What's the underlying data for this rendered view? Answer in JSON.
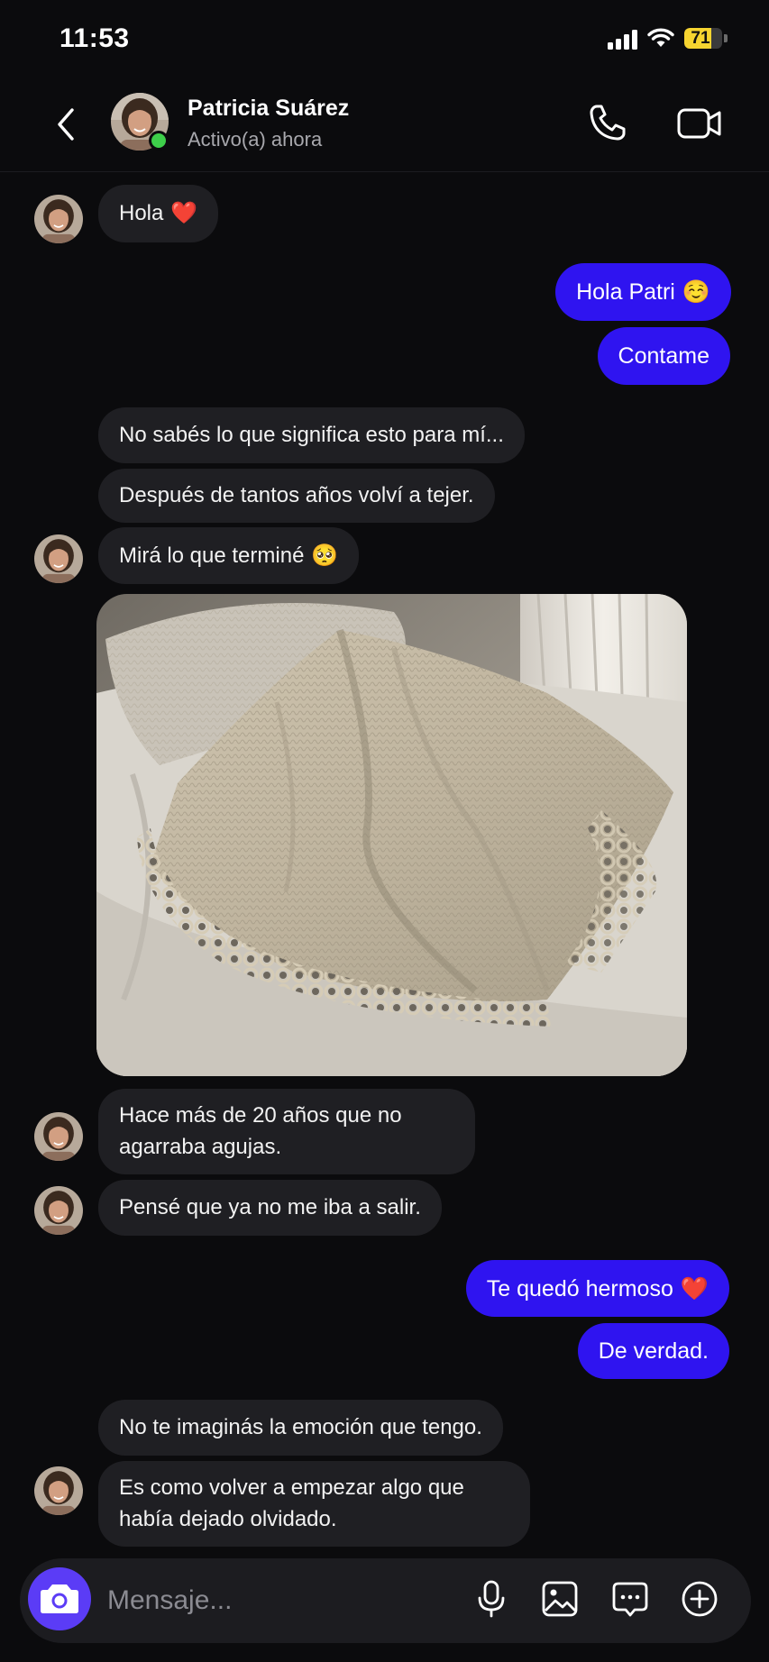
{
  "status_bar": {
    "time": "11:53",
    "battery_level": "71",
    "battery_fraction": 0.71,
    "signal_icon": "cellular-signal-icon",
    "wifi_icon": "wifi-icon"
  },
  "header": {
    "contact_name": "Patricia Suárez",
    "contact_status": "Activo(a) ahora",
    "back_icon": "chevron-left-icon",
    "call_icon": "phone-icon",
    "video_icon": "video-camera-icon"
  },
  "messages": {
    "m1": {
      "text": "Hola",
      "emoji": "❤️"
    },
    "m2": {
      "text": "Hola Patri",
      "emoji": "☺️"
    },
    "m3": {
      "text": "Contame"
    },
    "m4": {
      "text": "No sabés lo que significa esto para mí..."
    },
    "m5": {
      "text": "Después de tantos años volví a tejer."
    },
    "m6": {
      "text": "Mirá lo que terminé",
      "emoji": "🥺"
    },
    "m7": {
      "text": "Hace más de 20 años que no agarraba agujas."
    },
    "m8": {
      "text": "Pensé que ya no me iba a salir."
    },
    "m9": {
      "text": "Te quedó hermoso",
      "emoji": "❤️"
    },
    "m10": {
      "text": "De verdad."
    },
    "m11": {
      "text": "No te imaginás la emoción que tengo."
    },
    "m12": {
      "text": "Es como volver a empezar algo que había dejado olvidado."
    }
  },
  "composer": {
    "placeholder": "Mensaje...",
    "camera_icon": "camera-icon",
    "mic_icon": "microphone-icon",
    "gallery_icon": "image-icon",
    "sticker_icon": "chat-bubble-icon",
    "add_icon": "plus-circle-icon"
  },
  "colors": {
    "background": "#0b0b0d",
    "incoming_bubble": "#1f1f23",
    "outgoing_bubble": "#2f14f0",
    "accent": "#5b3cf6",
    "online": "#3ecf4a"
  }
}
